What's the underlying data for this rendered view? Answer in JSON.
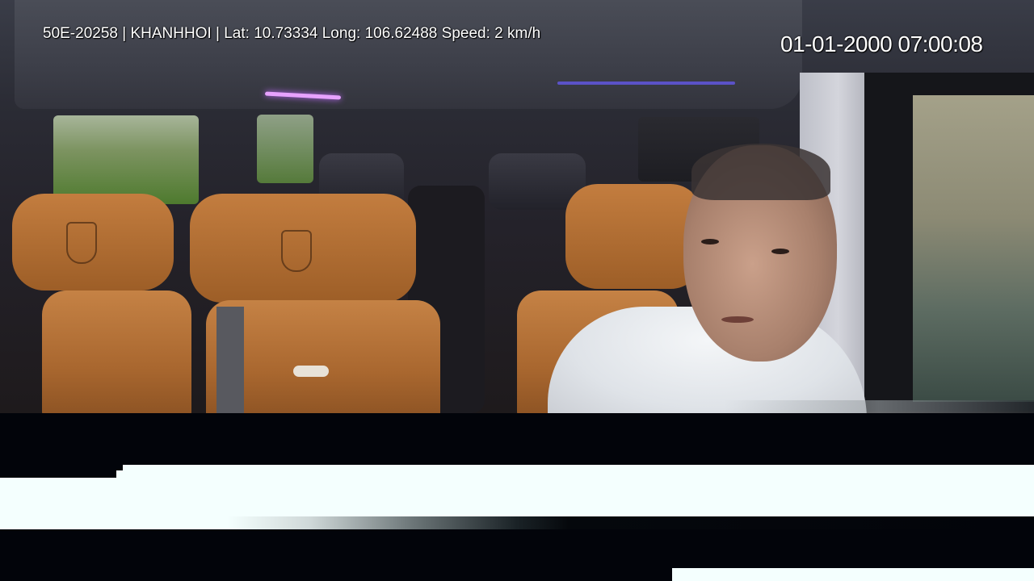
{
  "overlay": {
    "info": "50E-20258 | KHANHHOI | Lat: 10.73334 Long: 106.62488 Speed: 2 km/h",
    "timestamp": "01-01-2000 07:00:08"
  }
}
